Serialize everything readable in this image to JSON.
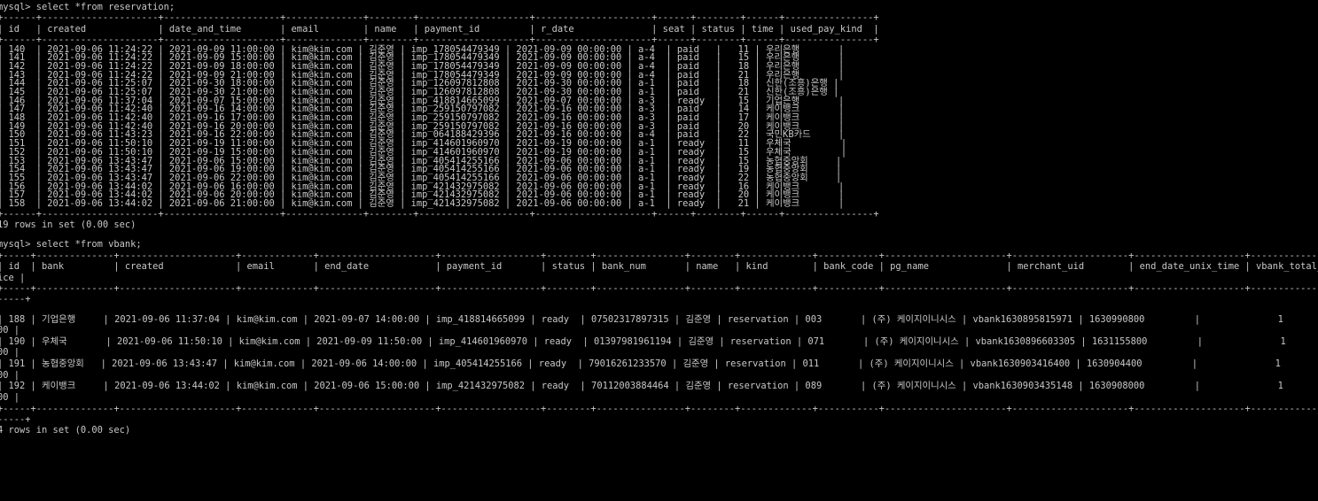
{
  "queries": {
    "q1": "mysql> select *from reservation;",
    "q2": "mysql> select *from vbank;"
  },
  "reservation": {
    "border": "+------+---------------------+---------------------+--------------+--------+--------------------+---------------------+------+--------+------+----------------+",
    "header": "| id   | created             | date_and_time       | email        | name   | payment_id         | r_date              | seat | status | time | used_pay_kind  |",
    "rows": [
      "| 140  | 2021-09-06 11:24:22 | 2021-09-09 11:00:00 | kim@kim.com | 김준영 | imp_178054479349 | 2021-09-09 00:00:00 | a-4  | paid   |   11 | 우리은행       |",
      "| 141  | 2021-09-06 11:24:22 | 2021-09-09 15:00:00 | kim@kim.com | 김준영 | imp_178054479349 | 2021-09-09 00:00:00 | a-4  | paid   |   15 | 우리은행       |",
      "| 142  | 2021-09-06 11:24:22 | 2021-09-09 18:00:00 | kim@kim.com | 김준영 | imp_178054479349 | 2021-09-09 00:00:00 | a-4  | paid   |   18 | 우리은행       |",
      "| 143  | 2021-09-06 11:24:22 | 2021-09-09 21:00:00 | kim@kim.com | 김준영 | imp_178054479349 | 2021-09-09 00:00:00 | a-4  | paid   |   21 | 우리은행       |",
      "| 144  | 2021-09-06 11:25:07 | 2021-09-30 18:00:00 | kim@kim.com | 김준영 | imp_126097812808 | 2021-09-30 00:00:00 | a-1  | paid   |   18 | 신한(조흥)은행 |",
      "| 145  | 2021-09-06 11:25:07 | 2021-09-30 21:00:00 | kim@kim.com | 김준영 | imp_126097812808 | 2021-09-30 00:00:00 | a-1  | paid   |   21 | 신한(조흥)은행 |",
      "| 146  | 2021-09-06 11:37:04 | 2021-09-07 15:00:00 | kim@kim.com | 김준영 | imp_418814665099 | 2021-09-07 00:00:00 | a-3  | ready  |   15 | 기업은행       |",
      "| 147  | 2021-09-06 11:42:40 | 2021-09-16 14:00:00 | kim@kim.com | 김준영 | imp_259150797082 | 2021-09-16 00:00:00 | a-3  | paid   |   14 | 케이뱅크       |",
      "| 148  | 2021-09-06 11:42:40 | 2021-09-16 17:00:00 | kim@kim.com | 김준영 | imp_259150797082 | 2021-09-16 00:00:00 | a-3  | paid   |   17 | 케이뱅크       |",
      "| 149  | 2021-09-06 11:42:40 | 2021-09-16 20:00:00 | kim@kim.com | 김준영 | imp_259150797082 | 2021-09-16 00:00:00 | a-3  | paid   |   20 | 케이뱅크       |",
      "| 150  | 2021-09-06 11:43:23 | 2021-09-16 22:00:00 | kim@kim.com | 김준영 | imp_064188429396 | 2021-09-16 00:00:00 | a-4  | paid   |   22 | 국민KB카드     |",
      "| 151  | 2021-09-06 11:50:10 | 2021-09-19 11:00:00 | kim@kim.com | 김준영 | imp_414601960970 | 2021-09-19 00:00:00 | a-1  | ready  |   11 | 우체국         |",
      "| 152  | 2021-09-06 11:50:10 | 2021-09-19 15:00:00 | kim@kim.com | 김준영 | imp_414601960970 | 2021-09-19 00:00:00 | a-1  | ready  |   15 | 우체국         |",
      "| 153  | 2021-09-06 13:43:47 | 2021-09-06 15:00:00 | kim@kim.com | 김준영 | imp_405414255166 | 2021-09-06 00:00:00 | a-1  | ready  |   15 | 농협중앙회     |",
      "| 154  | 2021-09-06 13:43:47 | 2021-09-06 19:00:00 | kim@kim.com | 김준영 | imp_405414255166 | 2021-09-06 00:00:00 | a-1  | ready  |   19 | 농협중앙회     |",
      "| 155  | 2021-09-06 13:43:47 | 2021-09-06 22:00:00 | kim@kim.com | 김준영 | imp_405414255166 | 2021-09-06 00:00:00 | a-1  | ready  |   22 | 농협중앙회     |",
      "| 156  | 2021-09-06 13:44:02 | 2021-09-06 16:00:00 | kim@kim.com | 김준영 | imp_421432975082 | 2021-09-06 00:00:00 | a-1  | ready  |   16 | 케이뱅크       |",
      "| 157  | 2021-09-06 13:44:02 | 2021-09-06 20:00:00 | kim@kim.com | 김준영 | imp_421432975082 | 2021-09-06 00:00:00 | a-1  | ready  |   20 | 케이뱅크       |",
      "| 158  | 2021-09-06 13:44:02 | 2021-09-06 21:00:00 | kim@kim.com | 김준영 | imp_421432975082 | 2021-09-06 00:00:00 | a-1  | ready  |   21 | 케이뱅크       |"
    ],
    "summary": "19 rows in set (0.00 sec)"
  },
  "vbank": {
    "border": "+-----+--------------+---------------------+-------------+---------------------+------------------+--------+----------------+--------+-------------+-----------+----------------------+---------------------+--------------------+-------------------",
    "header_l1": "| id  | bank         | created             | email       | end_date            | payment_id       | status | bank_num       | name   | kind        | bank_code | pg_name              | merchant_uid        | end_date_unix_time | vbank_total_pr",
    "header_l2": "ice |",
    "border_wrap": "-----+",
    "rows": [
      {
        "l1": "| 188 | 기업은행     | 2021-09-06 11:37:04 | kim@kim.com | 2021-09-07 14:00:00 | imp_418814665099 | ready  | 07502317897315 | 김준영 | reservation | 003       | (주) 케이지이니시스 | vbank1630895815971 | 1630990800         |              1",
        "l2": "00 |"
      },
      {
        "l1": "| 190 | 우체국       | 2021-09-06 11:50:10 | kim@kim.com | 2021-09-09 11:50:00 | imp_414601960970 | ready  | 01397981961194 | 김준영 | reservation | 071       | (주) 케이지이니시스 | vbank1630896603305 | 1631155800         |              1",
        "l2": "00 |"
      },
      {
        "l1": "| 191 | 농협중앙회   | 2021-09-06 13:43:47 | kim@kim.com | 2021-09-06 14:00:00 | imp_405414255166 | ready  | 79016261233570 | 김준영 | reservation | 011       | (주) 케이지이니시스 | vbank1630903416400 | 1630904400         |              1",
        "l2": "00 |"
      },
      {
        "l1": "| 192 | 케이뱅크     | 2021-09-06 13:44:02 | kim@kim.com | 2021-09-06 15:00:00 | imp_421432975082 | ready  | 70112003884464 | 김준영 | reservation | 089       | (주) 케이지이니시스 | vbank1630903435148 | 1630908000         |              1",
        "l2": "00 |"
      }
    ],
    "summary": "4 rows in set (0.00 sec)"
  }
}
